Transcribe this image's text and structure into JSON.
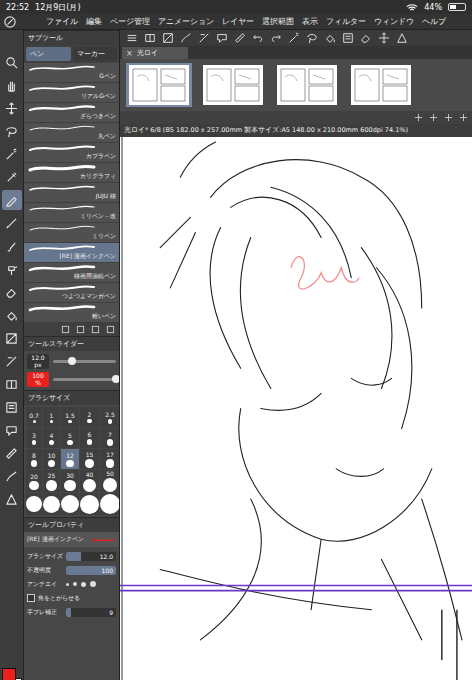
{
  "status_bar": {
    "time": "22:52",
    "date": "12月9日(月)",
    "battery": "44%",
    "battery_level": 0.44
  },
  "menu": [
    "ファイル",
    "編集",
    "ページ管理",
    "アニメーション",
    "レイヤー",
    "選択範囲",
    "表示",
    "フィルター",
    "ウィンドウ",
    "ヘルプ"
  ],
  "tools": [
    {
      "selected": false
    },
    {
      "selected": false
    },
    {
      "selected": false
    },
    {
      "selected": false
    },
    {
      "selected": false
    },
    {
      "selected": false
    },
    {
      "selected": true
    },
    {
      "selected": false
    },
    {
      "selected": false
    },
    {
      "selected": false
    },
    {
      "selected": false
    },
    {
      "selected": false
    },
    {
      "selected": false
    },
    {
      "selected": false
    },
    {
      "selected": false
    },
    {
      "selected": false
    },
    {
      "selected": false
    },
    {
      "selected": false
    },
    {
      "selected": false
    },
    {
      "selected": false
    }
  ],
  "colors": {
    "main": "#e8211d",
    "sub": "#ffffff"
  },
  "subtool": {
    "title": "サブツール",
    "tabs": [
      {
        "label": "ペン",
        "selected": true
      },
      {
        "label": "マーカー",
        "selected": false
      }
    ],
    "brushes": [
      {
        "name": "Gペン",
        "selected": false
      },
      {
        "name": "リアルGペン",
        "selected": false
      },
      {
        "name": "ざらつきペン",
        "selected": false
      },
      {
        "name": "丸ペン",
        "selected": false
      },
      {
        "name": "カブラペン",
        "selected": false
      },
      {
        "name": "カリグラフィ",
        "selected": false
      },
      {
        "name": "JUJU 線",
        "selected": false
      },
      {
        "name": "ミリペン - 改",
        "selected": false
      },
      {
        "name": "ミリペン",
        "selected": false
      },
      {
        "name": "[RE] 漫画インクペン",
        "selected": true
      },
      {
        "name": "線画用油絵ペン",
        "selected": false
      },
      {
        "name": "つよつよマンガペン",
        "selected": false
      },
      {
        "name": "粗いペン",
        "selected": false
      }
    ]
  },
  "tool_slider": {
    "title": "ツールスライダー",
    "size": "12.0",
    "size_unit": "px",
    "size_level": 0.3,
    "opacity": "100",
    "opacity_unit": "%",
    "opacity_level": 1
  },
  "brush_size": {
    "title": "ブラシサイズ",
    "sizes": [
      {
        "label": "0.7",
        "selected": false
      },
      {
        "label": "1",
        "selected": false
      },
      {
        "label": "1.5",
        "selected": false
      },
      {
        "label": "2",
        "selected": false
      },
      {
        "label": "2.5",
        "selected": false
      },
      {
        "label": "3",
        "selected": false
      },
      {
        "label": "4",
        "selected": false
      },
      {
        "label": "5",
        "selected": false
      },
      {
        "label": "6",
        "selected": false
      },
      {
        "label": "7",
        "selected": false
      },
      {
        "label": "8",
        "selected": false
      },
      {
        "label": "10",
        "selected": false
      },
      {
        "label": "12",
        "selected": true
      },
      {
        "label": "15",
        "selected": false
      },
      {
        "label": "17",
        "selected": false
      },
      {
        "label": "20",
        "selected": false
      },
      {
        "label": "25",
        "selected": false
      },
      {
        "label": "30",
        "selected": false
      },
      {
        "label": "40",
        "selected": false
      },
      {
        "label": "50",
        "selected": false
      }
    ]
  },
  "tool_property": {
    "title": "ツールプロパティ",
    "tool": "[RE] 漫画インクペン",
    "rows": [
      {
        "kind": "slider",
        "label": "ブラシサイズ",
        "value": "12.0",
        "level": 0.3
      },
      {
        "kind": "slider",
        "label": "不透明度",
        "value": "100",
        "level": 1
      },
      {
        "kind": "choice",
        "label": "アンチエイ"
      },
      {
        "kind": "checkbox",
        "label": "角をとがらせる",
        "checked": false
      },
      {
        "kind": "slider",
        "label": "手ブレ補正",
        "value": "9",
        "level": 0.1
      }
    ]
  },
  "document_tab": {
    "label": "光ロイ",
    "close": "×"
  },
  "pages": [
    {
      "selected": true
    },
    {
      "selected": false
    },
    {
      "selected": false
    },
    {
      "selected": false
    }
  ],
  "canvas": {
    "title": "光ロイ* 6/8 (B5 182.00 x 257.00mm 製本サイズ:A5 148.00 x 210.00mm 600dpi 74.1%)"
  }
}
